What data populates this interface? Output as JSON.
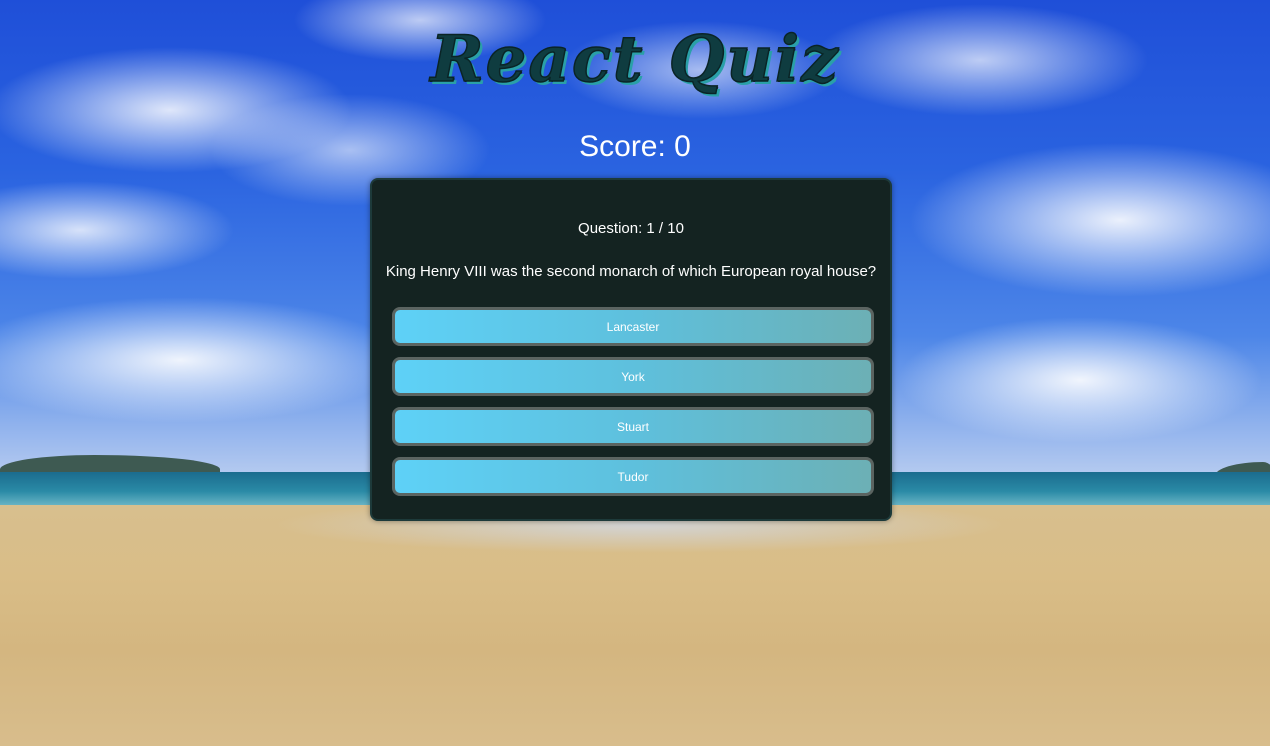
{
  "app": {
    "title": "React Quiz"
  },
  "score": {
    "label": "Score: 0"
  },
  "quiz": {
    "question_counter": "Question: 1 / 10",
    "question_text": "King Henry VIII was the second monarch of which European royal house?",
    "answers": [
      {
        "label": "Lancaster"
      },
      {
        "label": "York"
      },
      {
        "label": "Stuart"
      },
      {
        "label": "Tudor"
      }
    ]
  },
  "colors": {
    "card_background": "#142321",
    "answer_gradient_start": "#5ed1f7",
    "answer_gradient_end": "#6cb0b5",
    "title_color": "#0f3c40"
  }
}
